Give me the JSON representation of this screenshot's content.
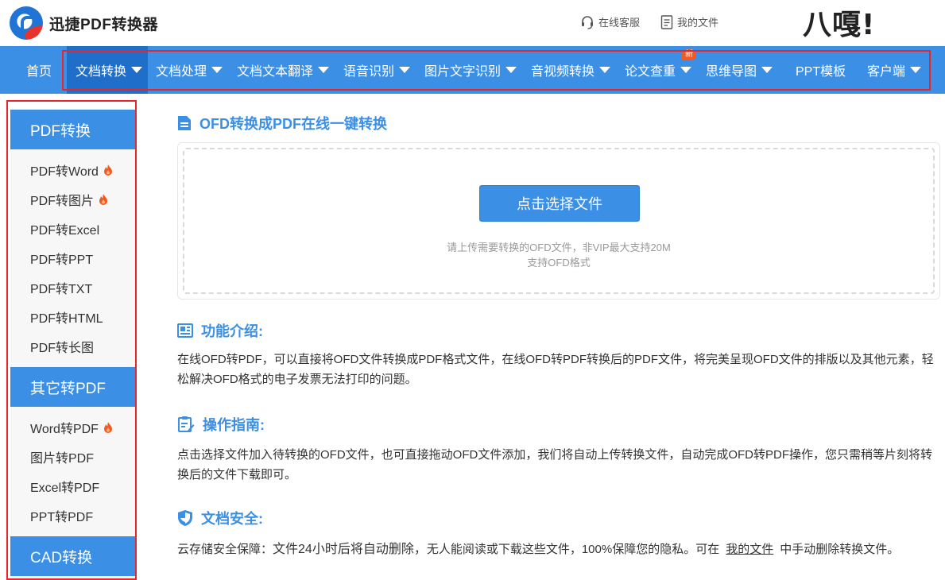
{
  "header": {
    "app_name": "迅捷PDF转换器",
    "service_label": "在线客服",
    "files_label": "我的文件",
    "promo_text": "八嘎!"
  },
  "nav": {
    "items": [
      {
        "label": "首页",
        "dropdown": false
      },
      {
        "label": "文档转换",
        "dropdown": true,
        "active": true
      },
      {
        "label": "文档处理",
        "dropdown": true
      },
      {
        "label": "文档文本翻译",
        "dropdown": true
      },
      {
        "label": "语音识别",
        "dropdown": true
      },
      {
        "label": "图片文字识别",
        "dropdown": true
      },
      {
        "label": "音视频转换",
        "dropdown": true
      },
      {
        "label": "论文查重",
        "dropdown": true,
        "badge": "新"
      },
      {
        "label": "思维导图",
        "dropdown": true
      },
      {
        "label": "PPT模板",
        "dropdown": false
      },
      {
        "label": "客户端",
        "dropdown": true
      }
    ]
  },
  "sidebar": {
    "groups": [
      {
        "title": "PDF转换",
        "items": [
          {
            "label": "PDF转Word",
            "hot": true
          },
          {
            "label": "PDF转图片",
            "hot": true
          },
          {
            "label": "PDF转Excel",
            "hot": false
          },
          {
            "label": "PDF转PPT",
            "hot": false
          },
          {
            "label": "PDF转TXT",
            "hot": false
          },
          {
            "label": "PDF转HTML",
            "hot": false
          },
          {
            "label": "PDF转长图",
            "hot": false
          }
        ]
      },
      {
        "title": "其它转PDF",
        "items": [
          {
            "label": "Word转PDF",
            "hot": true
          },
          {
            "label": "图片转PDF",
            "hot": false
          },
          {
            "label": "Excel转PDF",
            "hot": false
          },
          {
            "label": "PPT转PDF",
            "hot": false
          }
        ]
      },
      {
        "title": "CAD转换",
        "items": []
      }
    ]
  },
  "main": {
    "title": "OFD转换成PDF在线一键转换",
    "upload": {
      "button_label": "点击选择文件",
      "hint_line1": "请上传需要转换的OFD文件，非VIP最大支持20M",
      "hint_line2": "支持OFD格式"
    },
    "features": {
      "heading": "功能介绍:",
      "text": "在线OFD转PDF，可以直接将OFD文件转换成PDF格式文件，在线OFD转PDF转换后的PDF文件，将完美呈现OFD文件的排版以及其他元素，轻松解决OFD格式的电子发票无法打印的问题。"
    },
    "guide": {
      "heading": "操作指南:",
      "text": "点击选择文件加入待转换的OFD文件，也可直接拖动OFD文件添加，我们将自动上传转换文件，自动完成OFD转PDF操作，您只需稍等片刻将转换后的文件下载即可。"
    },
    "security": {
      "heading": "文档安全:",
      "text_prefix": "云存储安全保障：",
      "text_big": "文件24小时后将自动删除，",
      "text_mid": "无人能阅读或下载这些文件，100%保障您的隐私。可在",
      "link_label": "我的文件",
      "text_suffix": "中手动删除转换文件。"
    }
  },
  "colors": {
    "brand_blue": "#3b8fe5",
    "nav_active": "#1f6ec9",
    "highlight_red": "#e5262b",
    "hot_orange": "#f25a22"
  }
}
